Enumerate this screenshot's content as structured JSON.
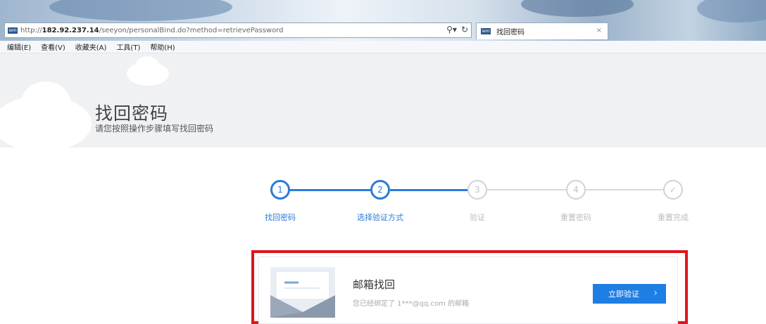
{
  "browser": {
    "url_prefix": "http://",
    "url_host": "182.92.237.14",
    "url_path": "/seeyon/personalBind.do?method=retrievePassword",
    "search_icon": "magnifier-icon",
    "refresh_icon": "refresh-icon",
    "tab_favicon": "iem",
    "tab_title": "找回密码",
    "tab_close": "×",
    "menu": [
      "编辑(E)",
      "查看(V)",
      "收藏夹(A)",
      "工具(T)",
      "帮助(H)"
    ]
  },
  "header": {
    "title": "找回密码",
    "subtitle": "请您按照操作步骤填写找回密码"
  },
  "steps": [
    {
      "number": "1",
      "label": "找回密码",
      "state": "active"
    },
    {
      "number": "2",
      "label": "选择验证方式",
      "state": "active"
    },
    {
      "number": "3",
      "label": "验证",
      "state": "inactive"
    },
    {
      "number": "4",
      "label": "重置密码",
      "state": "inactive"
    },
    {
      "number": "✓",
      "label": "重置完成",
      "state": "inactive"
    }
  ],
  "card": {
    "title": "邮箱找回",
    "description": "您已经绑定了 1***@qq.com 的邮箱",
    "button_label": "立即验证",
    "button_chevron": "›"
  },
  "colors": {
    "accent": "#2b7bd8",
    "button": "#1e7ee3",
    "highlight": "#e0141b"
  }
}
